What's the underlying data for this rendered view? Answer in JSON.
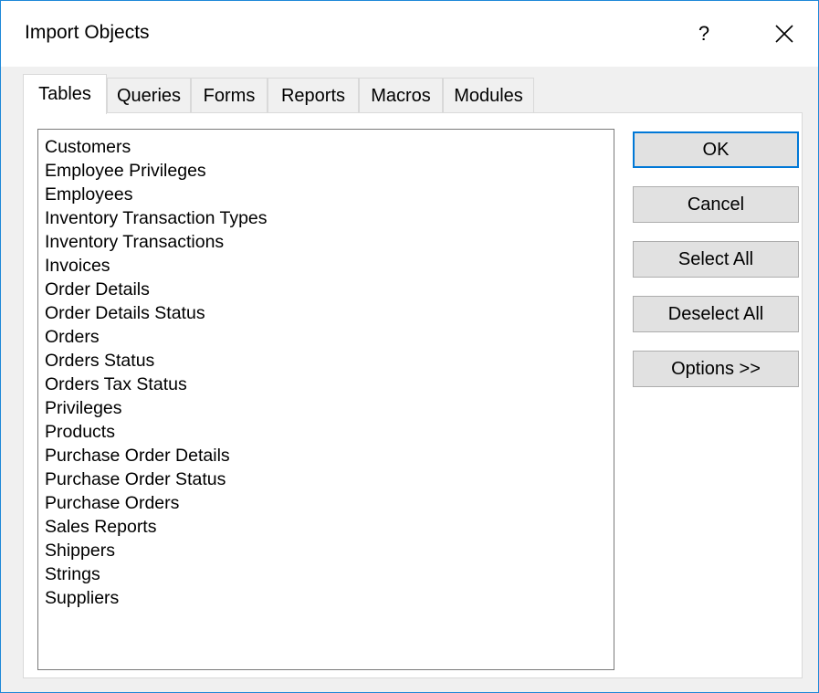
{
  "window": {
    "title": "Import Objects",
    "help_label": "?",
    "close_icon": "close-icon"
  },
  "tabs": [
    {
      "label": "Tables",
      "active": true
    },
    {
      "label": "Queries",
      "active": false
    },
    {
      "label": "Forms",
      "active": false
    },
    {
      "label": "Reports",
      "active": false
    },
    {
      "label": "Macros",
      "active": false
    },
    {
      "label": "Modules",
      "active": false
    }
  ],
  "list": {
    "items": [
      "Customers",
      "Employee Privileges",
      "Employees",
      "Inventory Transaction Types",
      "Inventory Transactions",
      "Invoices",
      "Order Details",
      "Order Details Status",
      "Orders",
      "Orders Status",
      "Orders Tax Status",
      "Privileges",
      "Products",
      "Purchase Order Details",
      "Purchase Order Status",
      "Purchase Orders",
      "Sales Reports",
      "Shippers",
      "Strings",
      "Suppliers"
    ]
  },
  "buttons": {
    "ok": "OK",
    "cancel": "Cancel",
    "select_all": "Select All",
    "deselect_all": "Deselect All",
    "options": "Options >>"
  },
  "colors": {
    "accent": "#0078d7",
    "dialog_bg": "#f0f0f0",
    "button_bg": "#e1e1e1"
  }
}
